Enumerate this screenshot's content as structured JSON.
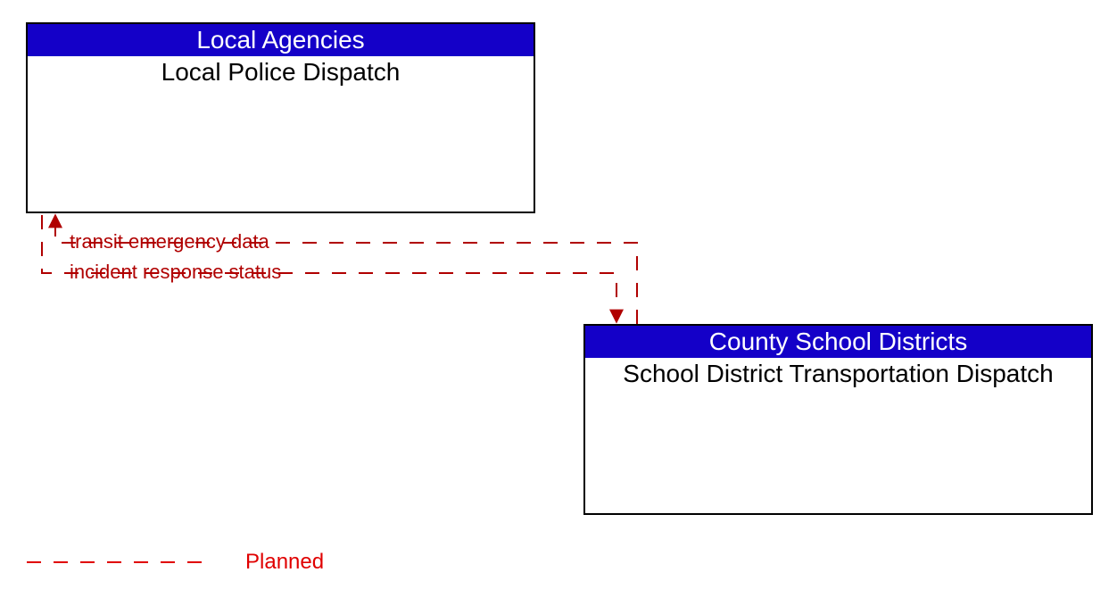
{
  "entities": {
    "left": {
      "header": "Local Agencies",
      "body": "Local Police Dispatch"
    },
    "right": {
      "header": "County School Districts",
      "body": "School District Transportation Dispatch"
    }
  },
  "flows": {
    "to_left": "transit emergency data",
    "to_right": "incident response status"
  },
  "legend": {
    "planned": "Planned"
  },
  "colors": {
    "header_bg": "#1400c8",
    "flow": "#b00000",
    "legend": "#e00000"
  }
}
